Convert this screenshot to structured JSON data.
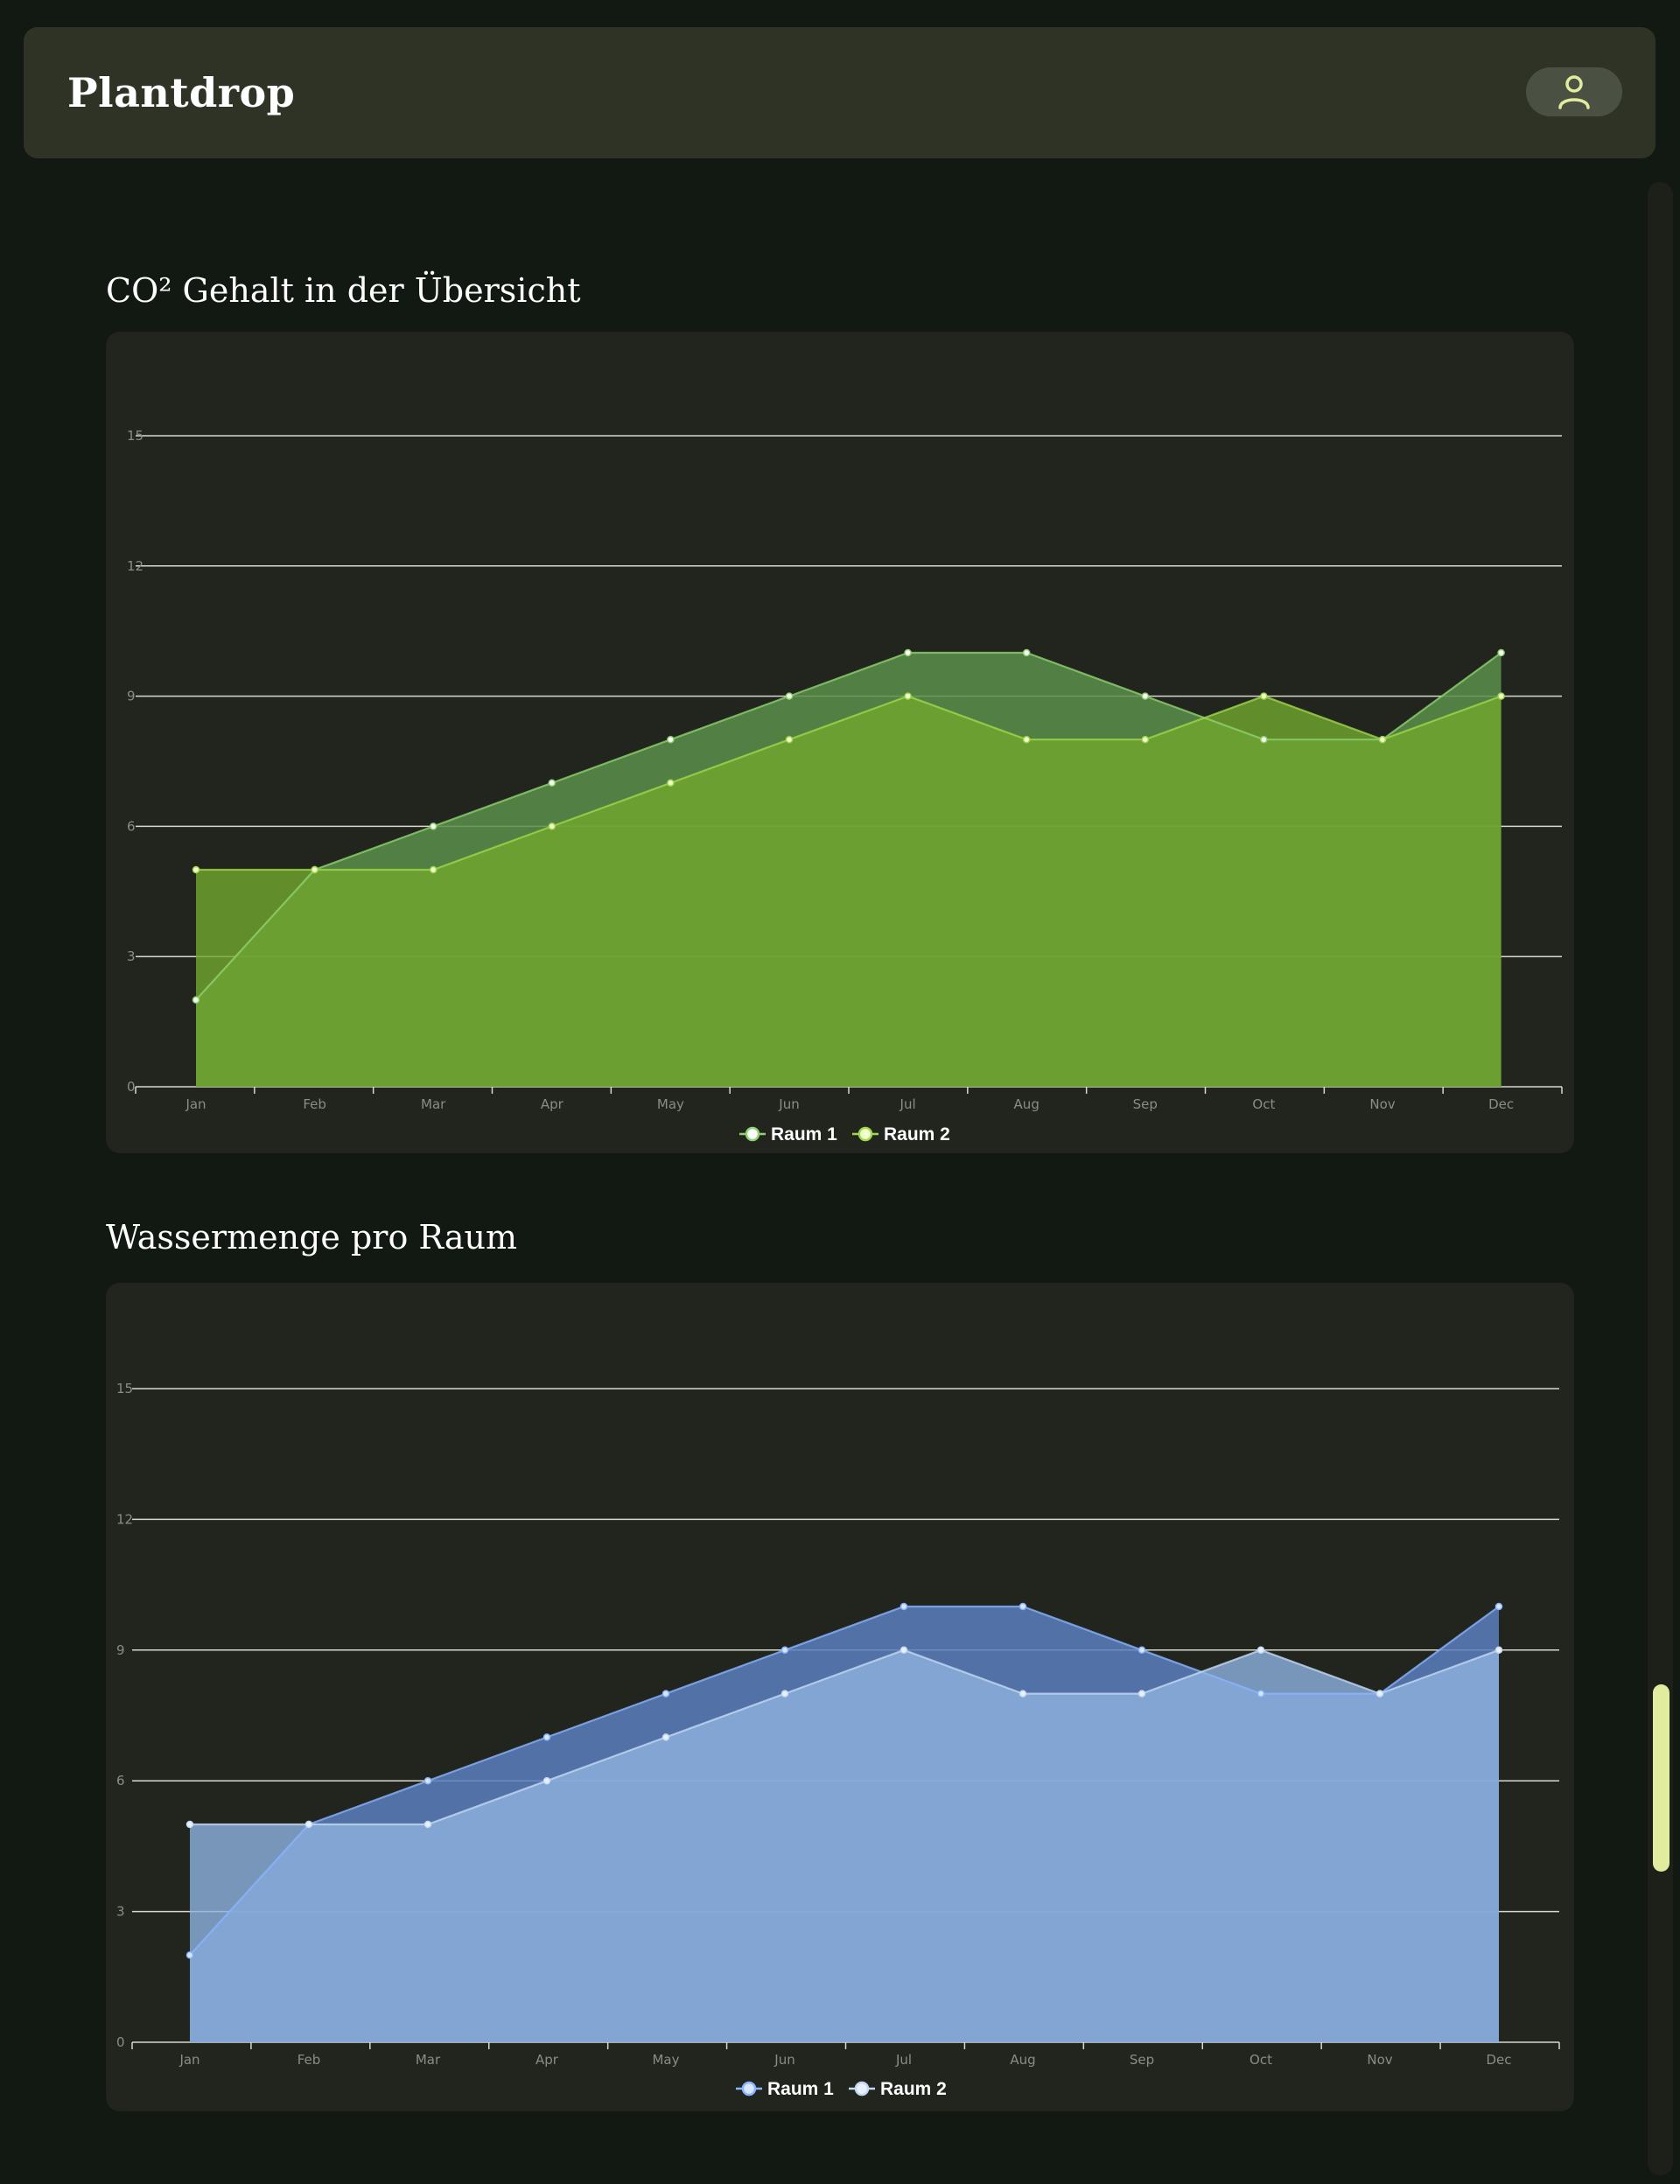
{
  "app": {
    "title": "Plantdrop"
  },
  "header": {
    "user_icon": "user-icon"
  },
  "sections": [
    {
      "title": "CO² Gehalt in der Übersicht"
    },
    {
      "title": "Wassermenge pro Raum"
    }
  ],
  "chart_data": [
    {
      "type": "area",
      "title": "CO² Gehalt in der Übersicht",
      "categories": [
        "Jan",
        "Feb",
        "Mar",
        "Apr",
        "May",
        "Jun",
        "Jul",
        "Aug",
        "Sep",
        "Oct",
        "Nov",
        "Dec"
      ],
      "yticks": [
        0,
        3,
        6,
        9,
        12,
        15
      ],
      "ylim": [
        0,
        17
      ],
      "grid": true,
      "legend_position": "bottom-center",
      "series": [
        {
          "name": "Raum 1",
          "values": [
            2,
            5,
            6,
            7,
            8,
            9,
            10,
            10,
            9,
            8,
            8,
            10
          ],
          "color": "#5a8f4a",
          "line": "#8fd26f",
          "marker": "#ffffff"
        },
        {
          "name": "Raum 2",
          "values": [
            5,
            5,
            5,
            6,
            7,
            8,
            9,
            8,
            8,
            9,
            8,
            9
          ],
          "color": "#73a82e",
          "line": "#9fd84a",
          "marker": "#f3ffd0"
        }
      ]
    },
    {
      "type": "area",
      "title": "Wassermenge pro Raum",
      "categories": [
        "Jan",
        "Feb",
        "Mar",
        "Apr",
        "May",
        "Jun",
        "Jul",
        "Aug",
        "Sep",
        "Oct",
        "Nov",
        "Dec"
      ],
      "yticks": [
        0,
        3,
        6,
        9,
        12,
        15
      ],
      "ylim": [
        0,
        17
      ],
      "grid": true,
      "legend_position": "bottom-center",
      "series": [
        {
          "name": "Raum 1",
          "values": [
            2,
            5,
            6,
            7,
            8,
            9,
            10,
            10,
            9,
            8,
            8,
            10
          ],
          "color": "#5b7fbf",
          "line": "#8ab4ff",
          "marker": "#d8e6ff"
        },
        {
          "name": "Raum 2",
          "values": [
            5,
            5,
            5,
            6,
            7,
            8,
            9,
            8,
            8,
            9,
            8,
            9
          ],
          "color": "#8fb3e0",
          "line": "#c4d8f2",
          "marker": "#e8f1ff"
        }
      ]
    }
  ]
}
